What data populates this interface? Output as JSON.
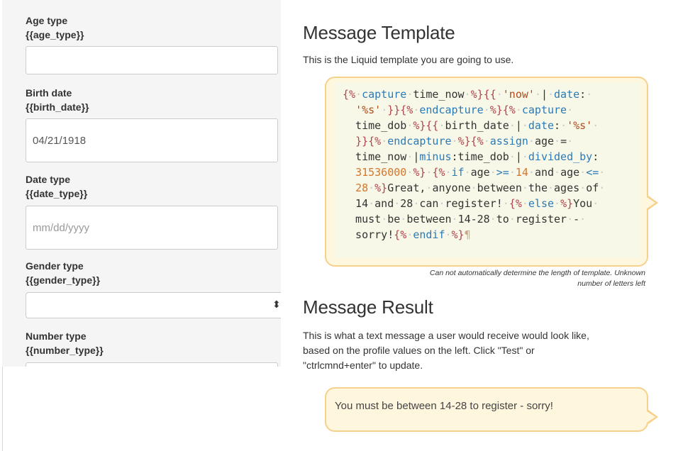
{
  "form": {
    "fields": [
      {
        "label": "Age type",
        "var": "{{age_type}}",
        "value": "",
        "placeholder": ""
      },
      {
        "label": "Birth date",
        "var": "{{birth_date}}",
        "value": "04/21/1918",
        "placeholder": ""
      },
      {
        "label": "Date type",
        "var": "{{date_type}}",
        "value": "",
        "placeholder": "mm/dd/yyyy"
      },
      {
        "label": "Gender type",
        "var": "{{gender_type}}",
        "selected": ""
      },
      {
        "label": "Number type",
        "var": "{{number_type}}",
        "value": ""
      }
    ]
  },
  "template_section": {
    "heading": "Message Template",
    "description": "This is the Liquid template you are going to use.",
    "length_note_line1": "Can not automatically determine the length of template. Unknown",
    "length_note_line2": "number of letters left"
  },
  "result_section": {
    "heading": "Message Result",
    "description_line1": "This is what a text message a user would receive would look like,",
    "description_line2": "based on the profile values on the left. Click \"Test\" or",
    "description_line3": "\"ctrlcmnd+enter\" to update.",
    "result_message": "You must be between 14-28 to register - sorry!"
  },
  "colors": {
    "bubble_fill": "#fff6de",
    "bubble_border": "#f6d18b",
    "liquid_delimiter": "#b1434d",
    "liquid_keyword": "#2a7ab8",
    "liquid_number": "#d6752b"
  }
}
